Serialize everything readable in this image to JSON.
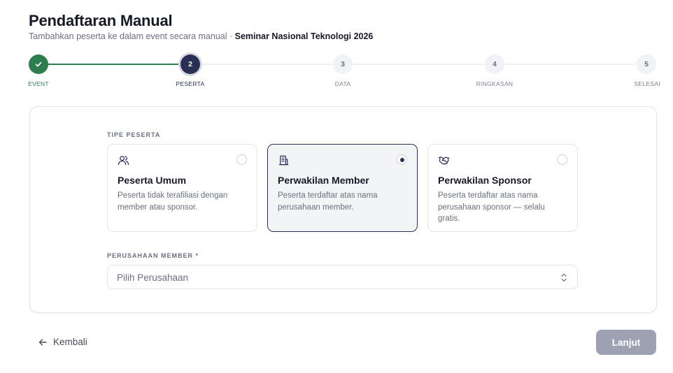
{
  "header": {
    "title": "Pendaftaran Manual",
    "subtitle": "Tambahkan peserta ke dalam event secara manual ·",
    "event_name": "Seminar Nasional Teknologi 2026"
  },
  "stepper": {
    "steps": [
      {
        "number": "1",
        "label": "EVENT",
        "state": "done",
        "icon": "check-icon"
      },
      {
        "number": "2",
        "label": "PESERTA",
        "state": "active"
      },
      {
        "number": "3",
        "label": "DATA",
        "state": "pending"
      },
      {
        "number": "4",
        "label": "RINGKASAN",
        "state": "pending"
      },
      {
        "number": "5",
        "label": "SELESAI",
        "state": "pending"
      }
    ],
    "colors": {
      "done": "#2e7d4f",
      "active": "#2a3054",
      "pending": "#f1f2f5"
    }
  },
  "form": {
    "type_label": "TIPE PESERTA",
    "options": [
      {
        "icon": "users-icon",
        "title": "Peserta Umum",
        "desc": "Peserta tidak terafiliasi dengan member atau sponsor.",
        "selected": false
      },
      {
        "icon": "building-icon",
        "title": "Perwakilan Member",
        "desc": "Peserta terdaftar atas nama perusahaan member.",
        "selected": true
      },
      {
        "icon": "handshake-icon",
        "title": "Perwakilan Sponsor",
        "desc": "Peserta terdaftar atas nama perusahaan sponsor — selalu gratis.",
        "selected": false
      }
    ],
    "company_label": "PERUSAHAAN MEMBER *",
    "company_select": {
      "placeholder": "Pilih Perusahaan",
      "value": "",
      "icon": "chevron-updown-icon"
    }
  },
  "footer": {
    "back_label": "Kembali",
    "back_icon": "arrow-left-icon",
    "next_label": "Lanjut",
    "next_color": "#9ea1b2"
  }
}
